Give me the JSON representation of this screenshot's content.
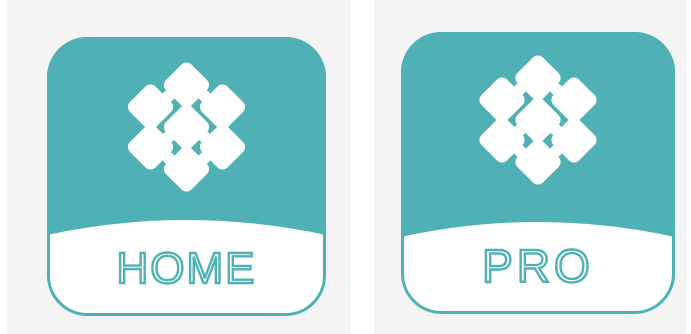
{
  "colors": {
    "teal": "#4fb1b5",
    "background": "#f4f4f4",
    "white": "#ffffff"
  },
  "logo": {
    "icon": "diamond-cluster-icon"
  },
  "apps": [
    {
      "label": "HOME"
    },
    {
      "label": "PRO"
    }
  ]
}
